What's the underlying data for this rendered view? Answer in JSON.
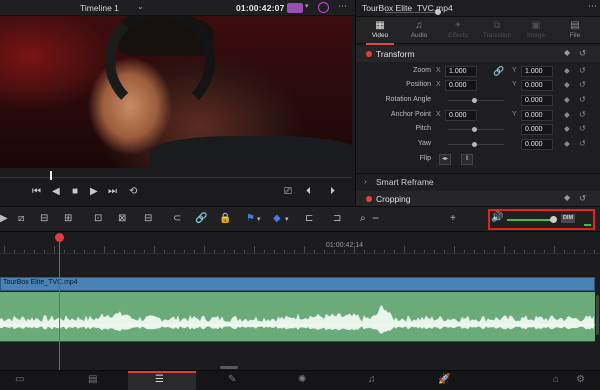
{
  "viewer": {
    "timeline_name": "Timeline 1",
    "timecode": "01:00:42:07",
    "transport_icons": [
      "skip-to-start-icon",
      "step-back-icon",
      "reverse-play-icon",
      "stop-icon",
      "play-icon",
      "skip-to-end-icon",
      "loop-icon",
      "match-frame-icon",
      "prev-edit-icon",
      "next-edit-icon"
    ]
  },
  "inspector": {
    "title": "TourBox Elite_TVC.mp4",
    "tabs": [
      {
        "label": "Video",
        "icon": "film-icon",
        "state": "active"
      },
      {
        "label": "Audio",
        "icon": "music-note-icon",
        "state": "normal"
      },
      {
        "label": "Effects",
        "icon": "magic-wand-icon",
        "state": "dim"
      },
      {
        "label": "Transition",
        "icon": "transition-icon",
        "state": "dim"
      },
      {
        "label": "Image",
        "icon": "image-icon",
        "state": "dim"
      },
      {
        "label": "File",
        "icon": "file-icon",
        "state": "normal"
      }
    ],
    "transform": {
      "label": "Transform",
      "zoom": {
        "label": "Zoom",
        "x_label": "X",
        "x": "1.000",
        "y_label": "Y",
        "y": "1.000"
      },
      "position": {
        "label": "Position",
        "x_label": "X",
        "x": "0.000",
        "y_label": "Y",
        "y": "0.000"
      },
      "rotation": {
        "label": "Rotation Angle",
        "value": "0.000"
      },
      "anchor": {
        "label": "Anchor Point",
        "x_label": "X",
        "x": "0.000",
        "y_label": "Y",
        "y": "0.000"
      },
      "pitch": {
        "label": "Pitch",
        "value": "0.000"
      },
      "yaw": {
        "label": "Yaw",
        "value": "0.000"
      },
      "flip": {
        "label": "Flip"
      }
    },
    "smart_reframe": {
      "label": "Smart Reframe"
    },
    "cropping": {
      "label": "Cropping"
    }
  },
  "timeline": {
    "ruler_timecode": "01:00:42:14",
    "clip_name": "TourBox Elite_TVC.mp4",
    "volume": {
      "level": 0.9,
      "dim_label": "DIM"
    },
    "colors": {
      "playhead": "#e03c3c",
      "clip": "#4a82b3",
      "audio": "#6aab79",
      "highlight": "#e3241b"
    }
  },
  "page_nav": {
    "items": [
      "media-icon",
      "cut-icon",
      "edit-icon",
      "fusion-icon",
      "color-icon",
      "fairlight-icon",
      "deliver-icon"
    ],
    "active": "edit-icon"
  }
}
